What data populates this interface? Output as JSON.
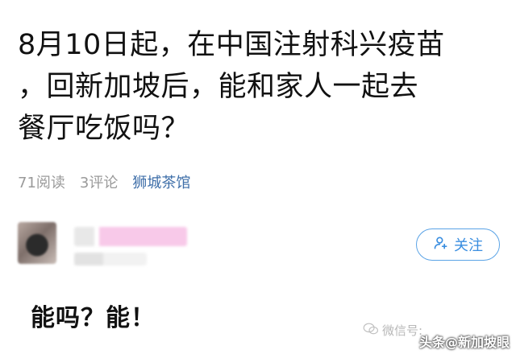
{
  "post": {
    "title_lines": [
      "8月10日起，在中国注射科兴疫苗",
      "，回新加坡后，能和家人一起去",
      "餐厅吃饭吗？"
    ],
    "reads": "71阅读",
    "comments": "3评论",
    "group": "狮城茶馆"
  },
  "author": {
    "follow_label": "关注"
  },
  "answer": {
    "text": "能吗？能！"
  },
  "watermarks": {
    "wechat": "微信号:",
    "toutiao": "头条@新加坡眼"
  },
  "colors": {
    "accent": "#3a8ee0",
    "meta_gray": "#9a9a9a",
    "group_link": "#3f6fa9"
  }
}
